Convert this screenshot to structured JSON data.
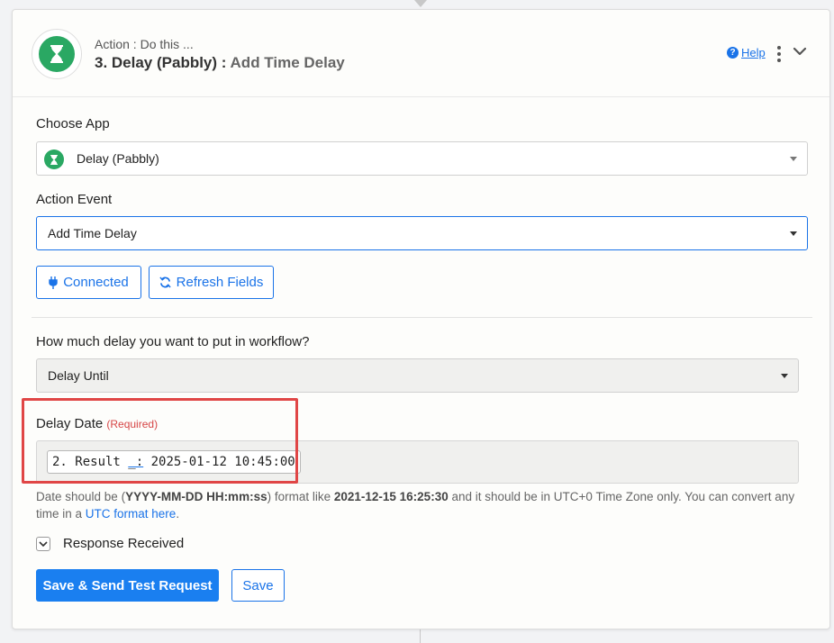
{
  "header": {
    "action_sub": "Action : Do this ...",
    "title_app": "3. Delay (Pabbly) :",
    "title_event": "Add Time Delay",
    "help_label": "Help",
    "app_icon": "hourglass-icon"
  },
  "choose_app": {
    "label": "Choose App",
    "value": "Delay (Pabbly)"
  },
  "action_event": {
    "label": "Action Event",
    "value": "Add Time Delay"
  },
  "buttons": {
    "connected_label": "Connected",
    "refresh_label": "Refresh Fields",
    "save_send_label": "Save & Send Test Request",
    "save_label": "Save"
  },
  "delay_question": {
    "label": "How much delay you want to put in workflow?",
    "value": "Delay Until"
  },
  "delay_date": {
    "label": "Delay Date",
    "required": "(Required)",
    "token_prefix": "2. Result",
    "token_sep": "_:",
    "token_value": "2025-01-12 10:45:00"
  },
  "hint": {
    "part1": "Date should be (",
    "format": "YYYY-MM-DD HH:mm:ss",
    "part2": ") format like ",
    "example": "2021-12-15 16:25:30",
    "part3": " and it should be in UTC+0 Time Zone only. You can convert any time in a ",
    "link": "UTC format here",
    "part4": "."
  },
  "response": {
    "label": "Response Received"
  },
  "colors": {
    "accent": "#1a73e8",
    "brand_green": "#2aa863",
    "required_red": "#d64545",
    "highlight_red": "#e04646"
  }
}
